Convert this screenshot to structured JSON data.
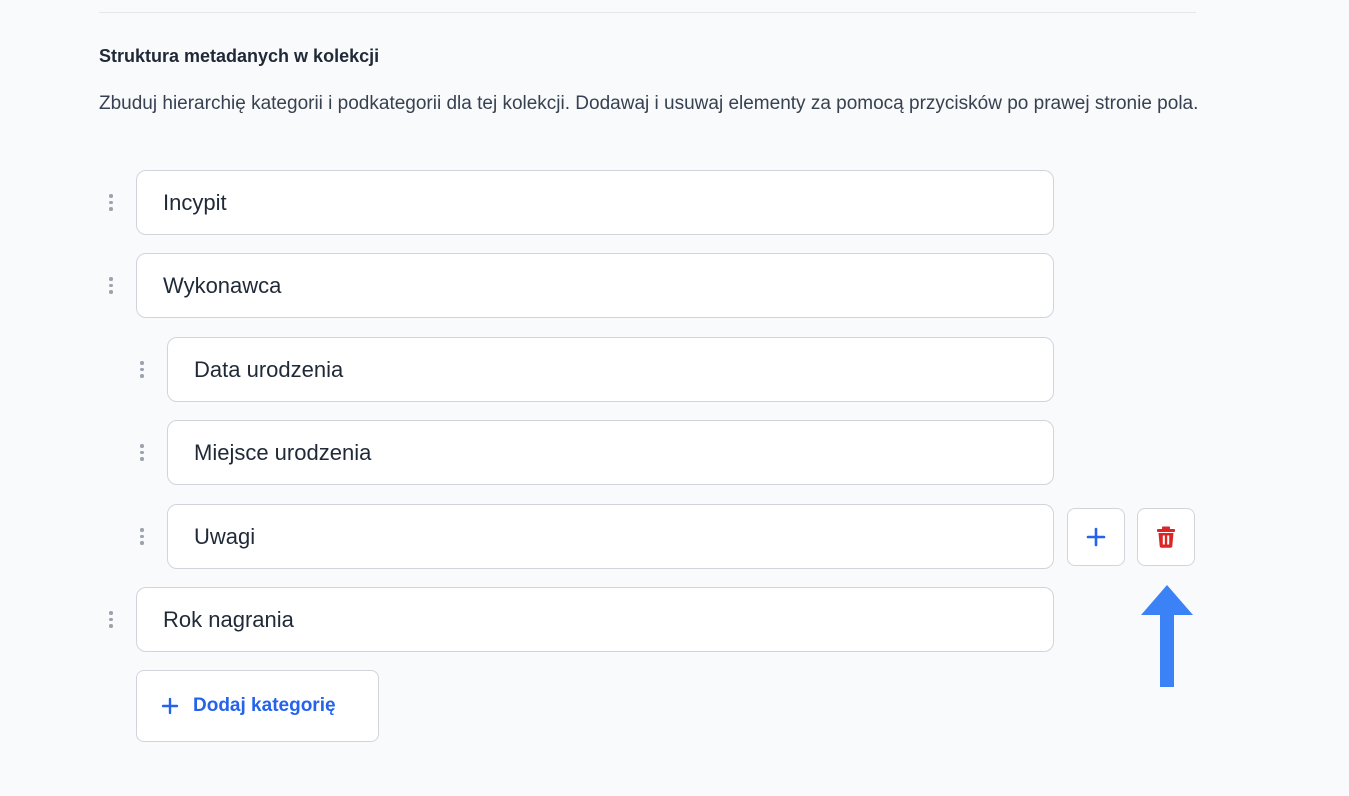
{
  "section": {
    "title": "Struktura metadanych w kolekcji",
    "description": "Zbuduj hierarchię kategorii i podkategorii dla tej kolekcji. Dodawaj i usuwaj elementy za pomocą przycisków po prawej stronie pola."
  },
  "categories": [
    {
      "value": "Incypit",
      "level": 0
    },
    {
      "value": "Wykonawca",
      "level": 0
    },
    {
      "value": "Data urodzenia",
      "level": 1
    },
    {
      "value": "Miejsce urodzenia",
      "level": 1
    },
    {
      "value": "Uwagi",
      "level": 1,
      "active": true
    },
    {
      "value": "Rok nagrania",
      "level": 0
    }
  ],
  "actions": {
    "add_icon": "plus-icon",
    "delete_icon": "trash-icon"
  },
  "add_category_label": "Dodaj kategorię",
  "colors": {
    "accent": "#2563eb",
    "danger": "#dc2626",
    "annotation_arrow": "#3b82f6"
  }
}
